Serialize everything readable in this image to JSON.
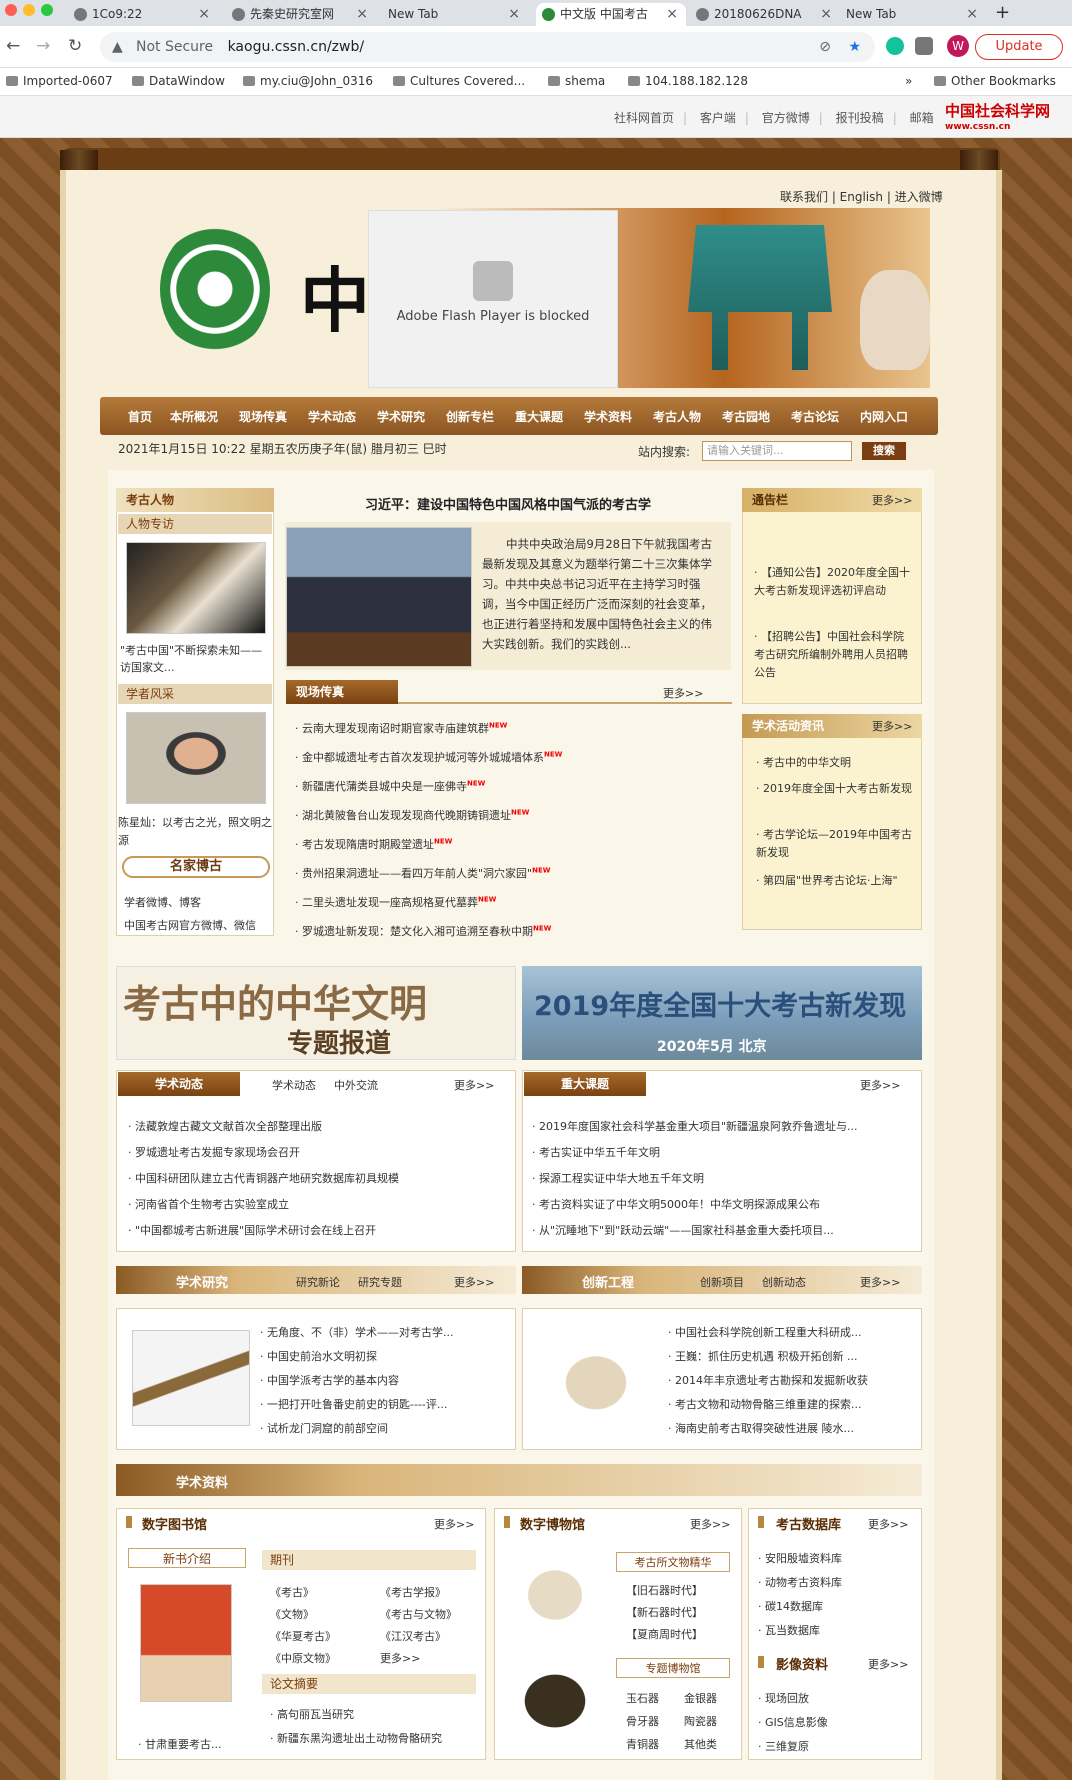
{
  "browser": {
    "tabs": [
      {
        "label": "1Co9:22"
      },
      {
        "label": "先秦史研究室网"
      },
      {
        "label": "New Tab"
      },
      {
        "label": "中文版 中国考古"
      },
      {
        "label": "20180626DNA"
      },
      {
        "label": "New Tab"
      }
    ],
    "url_security": "Not Secure",
    "url": "kaogu.cssn.cn/zwb/",
    "update_label": "Update",
    "profile_initial": "W",
    "bookmarks": [
      "Imported-0607",
      "DataWindow",
      "my.ciu@John_0316",
      "Cultures Covered...",
      "shema",
      "104.188.182.128"
    ],
    "bookmarks_more": "»",
    "other_bookmarks": "Other Bookmarks"
  },
  "topbar": {
    "links": [
      "社科网首页",
      "客户端",
      "官方微博",
      "报刊投稿",
      "邮箱"
    ],
    "logo": "中国社会科学网",
    "logo_url": "www.cssn.cn"
  },
  "header": {
    "links": "联系我们 | English | 进入微博",
    "flash_msg": "Adobe Flash Player is blocked",
    "banner_char": "中"
  },
  "nav": [
    "首页",
    "本所概况",
    "现场传真",
    "学术动态",
    "学术研究",
    "创新专栏",
    "重大课题",
    "学术资料",
    "考古人物",
    "考古园地",
    "考古论坛",
    "内网入口"
  ],
  "datebar": {
    "date": "2021年1月15日 10:22 星期五农历庚子年(鼠) 腊月初三 巳时",
    "search_label": "站内搜索:",
    "search_placeholder": "请输入关键词...",
    "search_btn": "搜索"
  },
  "left": {
    "title": "考古人物",
    "interview": "人物专访",
    "interview_caption": "\"考古中国\"不断探索未知——访国家文...",
    "scholar": "学者风采",
    "scholar_caption": "陈星灿：以考古之光，照文明之源",
    "famous": "名家博古",
    "famous_links": [
      "学者微博、博客",
      "中国考古网官方微博、微信"
    ]
  },
  "lead": {
    "title": "习近平：建设中国特色中国风格中国气派的考古学",
    "summary": "中共中央政治局9月28日下午就我国考古最新发现及其意义为题举行第二十三次集体学习。中共中央总书记习近平在主持学习时强调，当今中国正经历广泛而深刻的社会变革，也正进行着坚持和发展中国特色社会主义的伟大实践创新。我们的实践创..."
  },
  "field": {
    "title": "现场传真",
    "more": "更多>>",
    "items": [
      "云南大理发现南诏时期官家寺庙建筑群",
      "金中都城遗址考古首次发现护城河等外城城墙体系",
      "新疆唐代蒲类县城中央是一座佛寺",
      "湖北黄陂鲁台山发现发现商代晚期铸铜遗址",
      "考古发现隋唐时期殿堂遗址",
      "贵州招果洞遗址——看四万年前人类\"洞穴家园\"",
      "二里头遗址发现一座高规格夏代墓葬",
      "罗城遗址新发现：楚文化入湘可追溯至春秋中期"
    ],
    "new": "NEW"
  },
  "notice": {
    "title": "通告栏",
    "more": "更多>>",
    "items": [
      "【通知公告】2020年度全国十大考古新发现评选初评启动",
      "【招聘公告】中国社会科学院考古研究所编制外聘用人员招聘公告"
    ]
  },
  "activities": {
    "title": "学术活动资讯",
    "more": "更多>>",
    "items": [
      "考古中的中华文明",
      "2019年度全国十大考古新发现",
      "考古学论坛—2019年中国考古新发现",
      "第四届\"世界考古论坛·上海\""
    ]
  },
  "promo": {
    "left_line1": "考古中的中华文明",
    "left_line2": "专题报道",
    "right_line1": "2019年度全国十大考古新发现",
    "right_line2": "2020年5月 北京"
  },
  "news": {
    "title": "学术动态",
    "tab1": "学术动态",
    "tab2": "中外交流",
    "more": "更多>>",
    "items": [
      "法藏敦煌古藏文文献首次全部整理出版",
      "罗城遗址考古发掘专家现场会召开",
      "中国科研团队建立古代青铜器产地研究数据库初具规模",
      "河南省首个生物考古实验室成立",
      "\"中国都城考古新进展\"国际学术研讨会在线上召开"
    ]
  },
  "major": {
    "title": "重大课题",
    "more": "更多>>",
    "items": [
      "2019年度国家社会科学基金重大项目\"新疆温泉阿敦乔鲁遗址与...",
      "考古实证中华五千年文明",
      "探源工程实证中华大地五千年文明",
      "考古资料实证了中华文明5000年！中华文明探源成果公布",
      "从\"沉睡地下\"到\"跃动云端\"——国家社科基金重大委托项目..."
    ]
  },
  "research": {
    "title": "学术研究",
    "tab1": "研究新论",
    "tab2": "研究专题",
    "more": "更多>>",
    "items": [
      "无角度、不（非）学术——对考古学...",
      "中国史前治水文明初探",
      "中国学派考古学的基本内容",
      "一把打开吐鲁番史前史的钥匙----评...",
      "试析龙门洞窟的前部空间"
    ]
  },
  "innovation": {
    "title": "创新工程",
    "tab1": "创新项目",
    "tab2": "创新动态",
    "more": "更多>>",
    "items": [
      "中国社会科学院创新工程重大科研成...",
      "王巍：抓住历史机遇 积极开拓创新 ...",
      "2014年丰京遗址考古勘探和发掘新收获",
      "考古文物和动物骨骼三维重建的探索...",
      "海南史前考古取得突破性进展 陵水..."
    ]
  },
  "materials": {
    "title": "学术资料"
  },
  "library": {
    "title": "数字图书馆",
    "more": "更多>>",
    "newbook": "新书介绍",
    "book_caption": "· 甘肃重要考古...",
    "journals_title": "期刊",
    "journals": [
      "《考古》",
      "《考古学报》",
      "《文物》",
      "《考古与文物》",
      "《华夏考古》",
      "《江汉考古》",
      "《中原文物》",
      "更多>>"
    ],
    "abstract_title": "论文摘要",
    "abstracts": [
      "高句丽瓦当研究",
      "新疆东黑沟遗址出土动物骨骼研究"
    ]
  },
  "museum": {
    "title": "数字博物馆",
    "more": "更多>>",
    "sub1": "考古所文物精华",
    "sub1_items": [
      "【旧石器时代】",
      "【新石器时代】",
      "【夏商周时代】"
    ],
    "sub2": "专题博物馆",
    "sub2_items": [
      "玉石器",
      "金银器",
      "骨牙器",
      "陶瓷器",
      "青铜器",
      "其他类"
    ]
  },
  "db": {
    "title": "考古数据库",
    "more": "更多>>",
    "items": [
      "安阳殷墟资料库",
      "动物考古资料库",
      "碳14数据库",
      "瓦当数据库"
    ],
    "image_title": "影像资料",
    "image_more": "更多>>",
    "image_items": [
      "现场回放",
      "GIS信息影像",
      "三维复原"
    ]
  }
}
